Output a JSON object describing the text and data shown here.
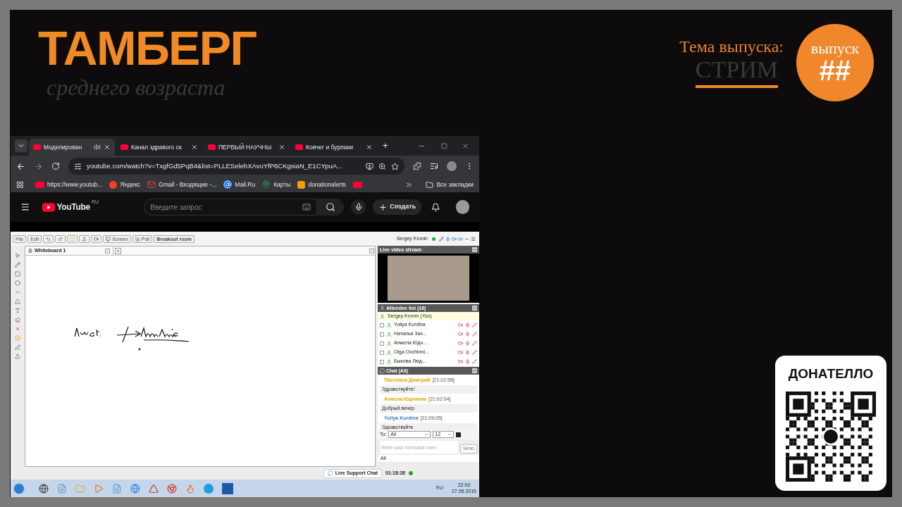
{
  "logo": {
    "title": "ТАМБЕРГ",
    "subtitle": "среднего возраста"
  },
  "episode": {
    "topic_label": "Тема выпуска:",
    "topic": "СТРИМ",
    "badge_label": "выпуск",
    "badge_number": "##"
  },
  "browser": {
    "tabs": [
      {
        "title": "Моделирован",
        "selected": true,
        "audio": true
      },
      {
        "title": "Канал здравого ск",
        "selected": false,
        "audio": false
      },
      {
        "title": "ПЕРВЫЙ НАУЧНЫ",
        "selected": false,
        "audio": false
      },
      {
        "title": "Ковчег и бурлаки",
        "selected": false,
        "audio": false
      }
    ],
    "new_tab": "+",
    "url": "youtube.com/watch?v=TxgfGd5PqB4&list=PLLESelehXAvuYfP6CKgsiaN_E1CYpuA...",
    "bookmarks": [
      {
        "kind": "youtube",
        "label": "https://www.youtub..."
      },
      {
        "kind": "yandex",
        "label": "Яндекс"
      },
      {
        "kind": "gmail",
        "label": "Gmail - Входящие -..."
      },
      {
        "kind": "mail",
        "label": "Mail.Ru"
      },
      {
        "kind": "maps",
        "label": "Карты"
      },
      {
        "kind": "donation",
        "label": "donationalerts"
      },
      {
        "kind": "youtube"
      }
    ],
    "all_bookmarks": "Все закладки"
  },
  "youtube": {
    "logo": "YouTube",
    "region": "RU",
    "search_placeholder": "Введите запрос",
    "create": "Создать"
  },
  "webinar": {
    "toolbar_left": [
      "File",
      "Edit"
    ],
    "toolbar_right": [
      "Screen",
      "Poll",
      "Breakout room"
    ],
    "user": "Sergey Kronin",
    "whiteboard_tab": "Whiteboard 1",
    "add_tab": "+",
    "video_panel": {
      "title": "Live video stream"
    },
    "attendees": {
      "title": "Attendee list (16)",
      "host": "Sergey Kronin (You)",
      "items": [
        {
          "name": "Yuliya Kurdina",
          "checked": false
        },
        {
          "name": "Наталья Зах...",
          "checked": false
        },
        {
          "name": "Анжела Юдч...",
          "checked": false
        },
        {
          "name": "Olga Ovchinni...",
          "checked": false
        },
        {
          "name": "Быкова Люд...",
          "checked": false
        }
      ]
    },
    "chat": {
      "title": "Chat (All)",
      "messages": [
        {
          "author": "Пасенков Дмитрий",
          "time": "[21:02:58]",
          "text": "Здравствуйте!",
          "color": "#e0a800"
        },
        {
          "author": "Анжела Юдчиева",
          "time": "[21:02:04]",
          "text": "Добрый вечер",
          "color": "#e0a800"
        },
        {
          "author": "Yuliya Kurdina",
          "time": "[21:09:05]",
          "text": "Здравствуйте",
          "color": "#3d7fb8"
        }
      ],
      "to_label": "To:",
      "recipient": "All",
      "font_size": "12",
      "placeholder": "Write your message here",
      "send": "Send",
      "filter": "All"
    },
    "support": "Live Support Chat",
    "timer": "01:18:28"
  },
  "taskbar": {
    "language": "RU",
    "time": "22:03",
    "date": "27.05.2015"
  },
  "donation": {
    "title": "ДОНАТЕЛЛО"
  }
}
